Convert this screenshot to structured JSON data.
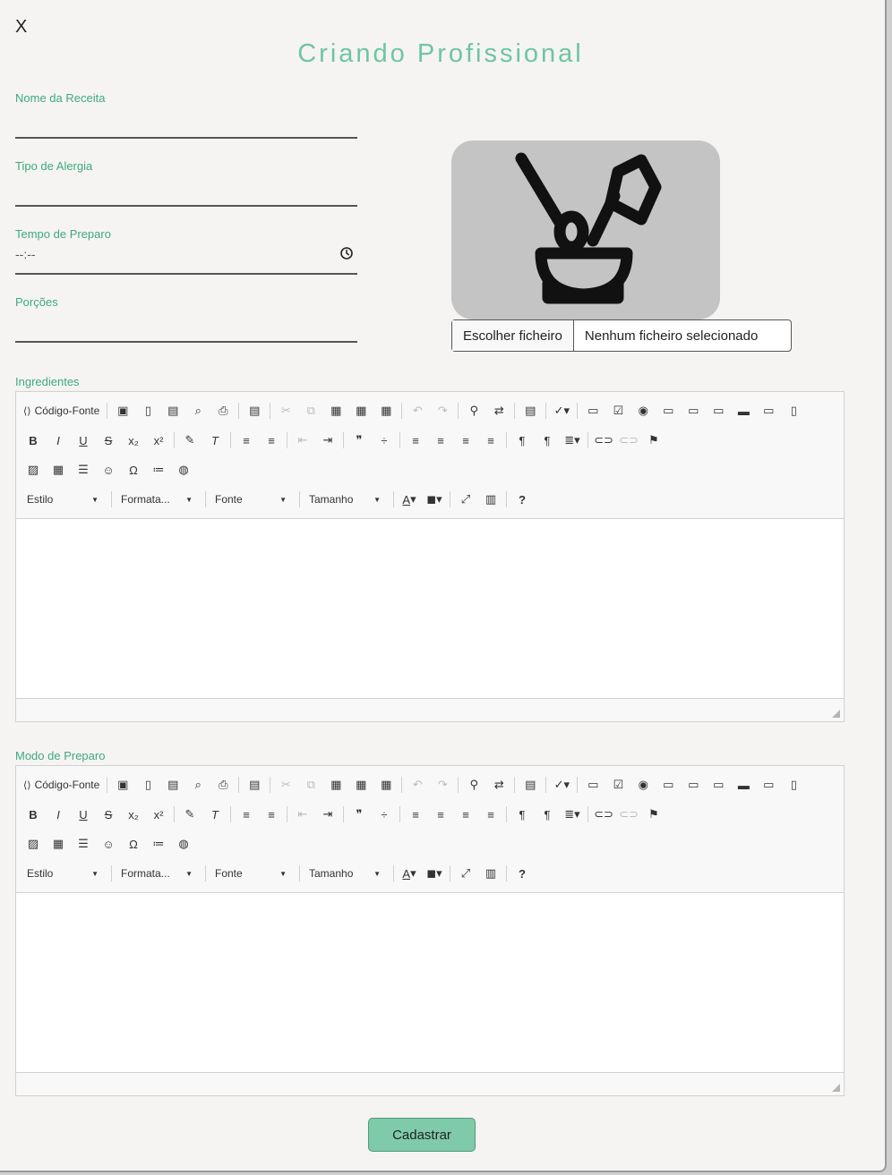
{
  "close_label": "X",
  "title": "Criando Profissional",
  "colors": {
    "accent": "#6ec5a4",
    "label": "#3eaa80",
    "button": "#7fcaa9"
  },
  "fields": [
    {
      "label": "Nome da Receita",
      "value": ""
    },
    {
      "label": "Tipo de Alergia",
      "value": ""
    },
    {
      "label": "Tempo de Preparo",
      "value": "--:--"
    },
    {
      "label": "Porções",
      "value": ""
    }
  ],
  "image": {
    "icon": "mortar-pestle-icon"
  },
  "file_input": {
    "button_label": "Escolher ficheiro",
    "status": "Nenhum ficheiro selecionado"
  },
  "editors": [
    {
      "label": "Ingredientes"
    },
    {
      "label": "Modo de Preparo"
    }
  ],
  "toolbar": {
    "source_label": "Código-Fonte",
    "combos": [
      "Estilo",
      "Formata...",
      "Fonte",
      "Tamanho"
    ],
    "help_label": "?"
  },
  "submit_label": "Cadastrar"
}
